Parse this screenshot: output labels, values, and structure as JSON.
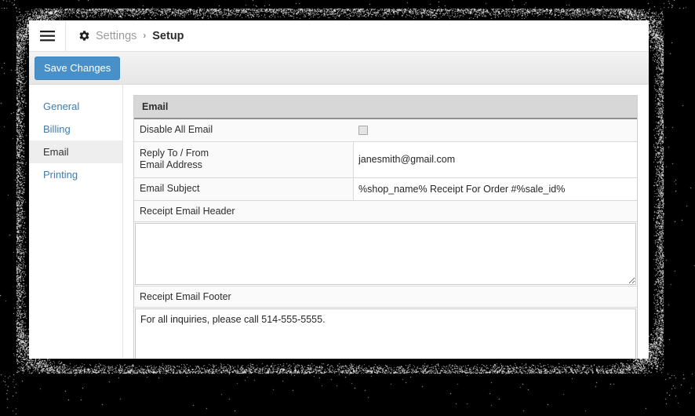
{
  "topbar": {
    "menu_icon": "hamburger-icon",
    "gear_icon": "gear-icon",
    "breadcrumb": {
      "parent": "Settings",
      "separator": "›",
      "current": "Setup"
    }
  },
  "toolbar": {
    "save_label": "Save Changes",
    "save_color": "#4a90c8"
  },
  "sidebar": {
    "items": [
      {
        "label": "General",
        "active": false
      },
      {
        "label": "Billing",
        "active": false
      },
      {
        "label": "Email",
        "active": true
      },
      {
        "label": "Printing",
        "active": false
      }
    ]
  },
  "panel": {
    "title": "Email",
    "rows": [
      {
        "label": "Disable All Email",
        "type": "checkbox",
        "checked": false
      },
      {
        "label": "Reply To / From Email Address",
        "label_line1": "Reply To / From",
        "label_line2": "Email Address",
        "type": "text",
        "value": "janesmith@gmail.com",
        "placeholder": ""
      },
      {
        "label": "Email Subject",
        "type": "text",
        "value": "%shop_name% Receipt For Order #%sale_id%",
        "placeholder": ""
      }
    ],
    "textareas": [
      {
        "label": "Receipt Email Header",
        "value": "",
        "placeholder": ""
      },
      {
        "label": "Receipt Email Footer",
        "value": "For all inquiries, please call 514-555-5555.",
        "placeholder": ""
      }
    ]
  }
}
